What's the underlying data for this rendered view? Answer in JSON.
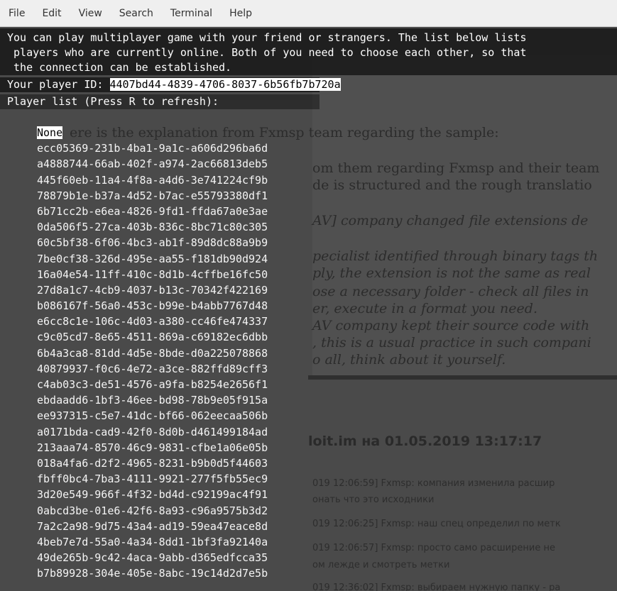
{
  "menubar": {
    "items": [
      "File",
      "Edit",
      "View",
      "Search",
      "Terminal",
      "Help"
    ]
  },
  "terminal": {
    "intro_lines": [
      "You can play multiplayer game with your friend or strangers. The list below lists",
      " players who are currently online. Both of you need to choose each other, so that",
      " the connection can be established."
    ],
    "player_id_label": "Your player ID: ",
    "player_id": "4407bd44-4839-4706-8037-6b56fb7b720a",
    "list_title": "Player list (Press R to refresh):",
    "players": [
      "None",
      "ecc05369-231b-4ba1-9a1c-a606d296ba6d",
      "a4888744-66ab-402f-a974-2ac66813deb5",
      "445f60eb-11a4-4f8a-a4d6-3e741224cf9b",
      "78879b1e-b37a-4d52-b7ac-e55793380df1",
      "6b71cc2b-e6ea-4826-9fd1-ffda67a0e3ae",
      "0da506f5-27ca-403b-836c-8bc71c80c305",
      "60c5bf38-6f06-4bc3-ab1f-89d8dc88a9b9",
      "7be0cf38-326d-495e-aa55-f181db90d924",
      "16a04e54-11ff-410c-8d1b-4cffbe16fc50",
      "27d8a1c7-4cb9-4037-b13c-70342f422169",
      "b086167f-56a0-453c-b99e-b4abb7767d48",
      "e6cc8c1e-106c-4d03-a380-cc46fe474337",
      "c9c05cd7-8e65-4511-869a-c69182ec6dbb",
      "6b4a3ca8-81dd-4d5e-8bde-d0a225078868",
      "40879937-f0c6-4e72-a3ce-882ffd89cff3",
      "c4ab03c3-de51-4576-a9fa-b8254e2656f1",
      "ebdaadd6-1bf3-46ee-bd98-78b9e05f915a",
      "ee937315-c5e7-41dc-bf66-062eecaa506b",
      "a0171bda-cad9-42f0-8d0b-d461499184ad",
      "213aaa74-8570-46c9-9831-cfbe1a06e05b",
      "018a4fa6-d2f2-4965-8231-b9b0d5f44603",
      "fbff0bc4-7ba3-4111-9921-277f5fb55ec9",
      "3d20e549-966f-4f32-bd4d-c92199ac4f91",
      "0abcd3be-01e6-42f6-8a93-c96a9575b3d2",
      "7a2c2a98-9d75-43a4-ad19-59ea47eace8d",
      "4beb7e7d-55a0-4a34-8dd1-1bf3fa92140a",
      "49de265b-9c42-4aca-9abb-d365edfcca35",
      "b7b89928-304e-405e-8abc-19c14d2d7e5b"
    ]
  },
  "background": {
    "article_fragments": [
      "ere is the explanation from Fxmsp team regarding the sample:",
      "om them regarding Fxmsp and their team",
      "de is structured and the rough translatio",
      "AV] company changed file extensions de",
      "pecialist identified through binary tags th",
      "ply, the extension is not the same as real",
      "ose a necessary folder - check all files in",
      "er, execute in a format you need.",
      "AV company kept their source code with",
      ", this is a usual practice in such compani",
      "o all, think about it yourself."
    ],
    "heading_fragment": "loit.im на 01.05.2019 13:17:17",
    "chat_fragments": [
      "019 12:06:59] Fxmsp: компания изменила расшир",
      "онать что это исходники",
      "019 12:06:25] Fxmsp: наш спец определил по метк",
      "019 12:06:57] Fxmsp: просто само расширение не",
      "ом лежде и смотреть метки",
      "019 12:36:02] Fxmsp: выбираем нужную папку - ра"
    ]
  }
}
